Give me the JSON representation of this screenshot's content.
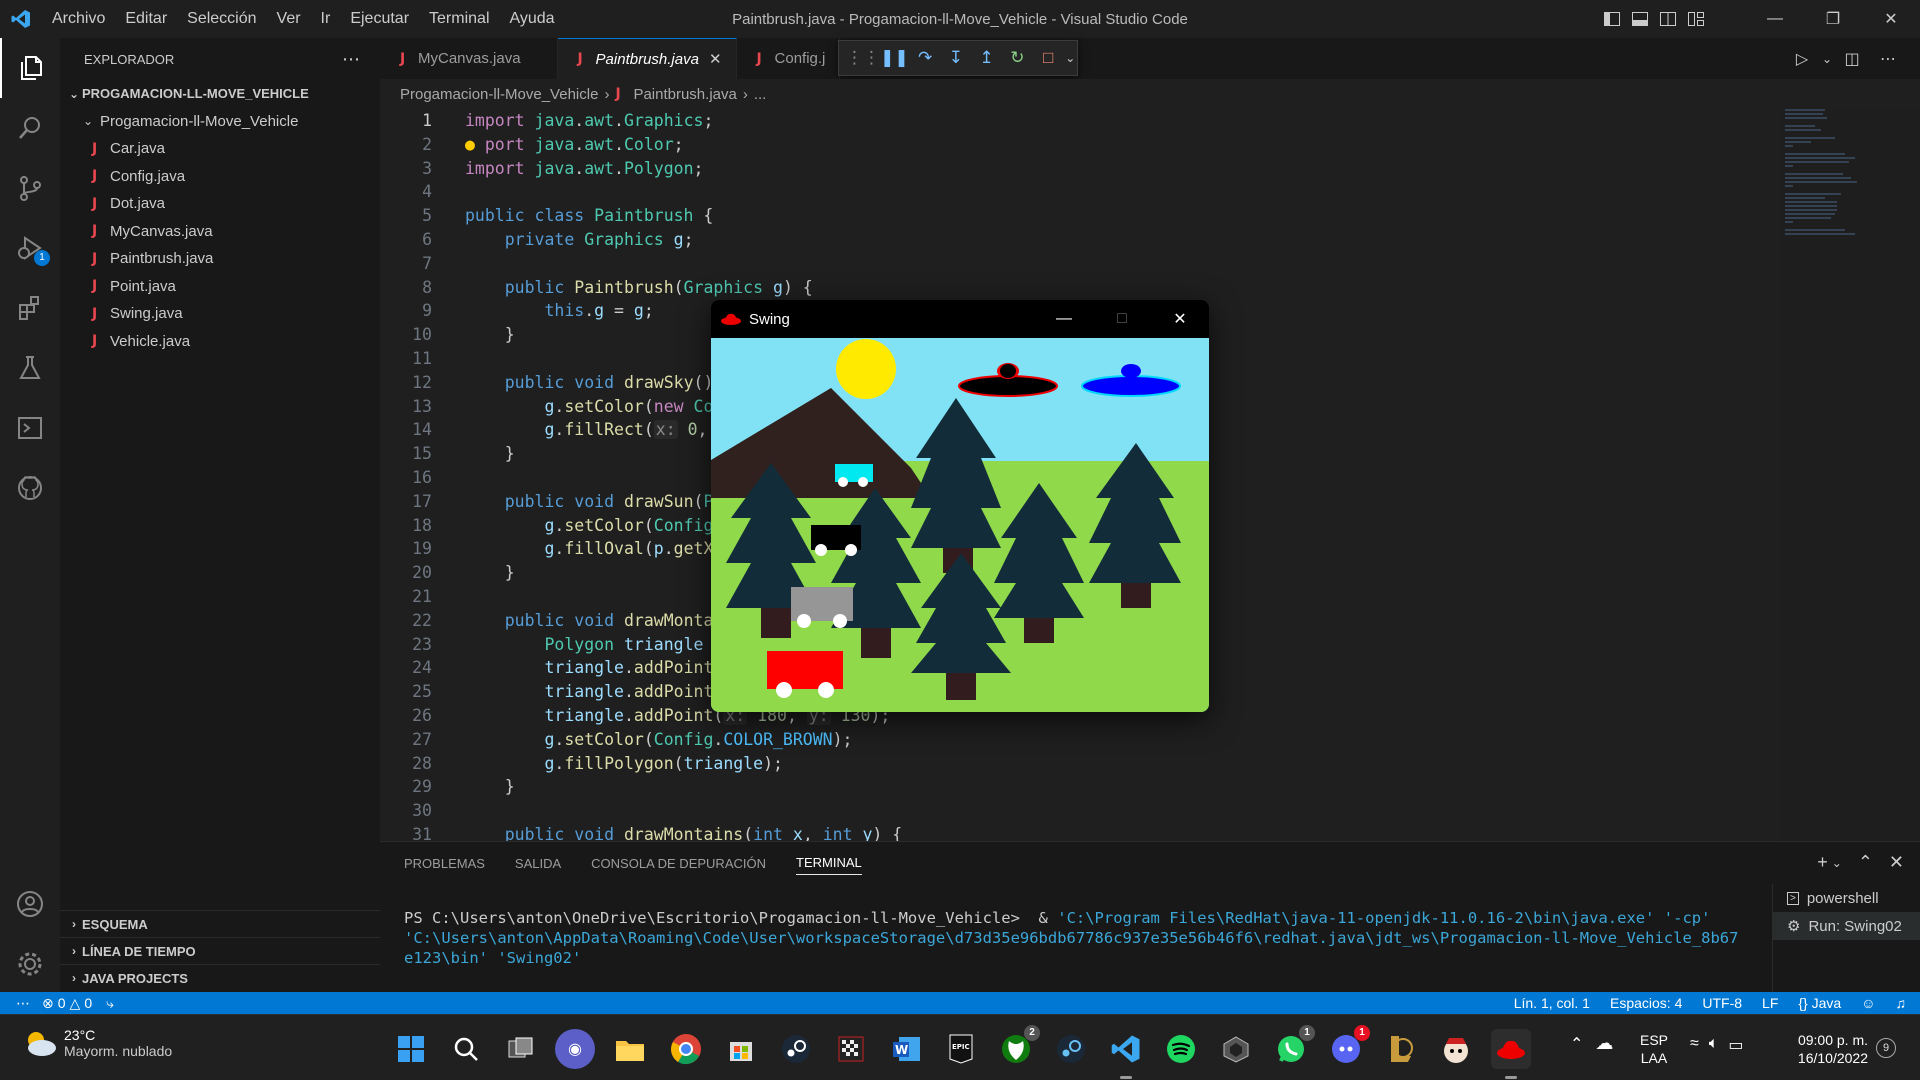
{
  "titlebar": {
    "menu": [
      "Archivo",
      "Editar",
      "Selección",
      "Ver",
      "Ir",
      "Ejecutar",
      "Terminal",
      "Ayuda"
    ],
    "window_title": "Paintbrush.java - Progamacion-ll-Move_Vehicle - Visual Studio Code"
  },
  "activity": {
    "debug_badge": "1"
  },
  "sidebar": {
    "header": "EXPLORADOR",
    "root": "PROGAMACION-LL-MOVE_VEHICLE",
    "folder": "Progamacion-ll-Move_Vehicle",
    "files": [
      "Car.java",
      "Config.java",
      "Dot.java",
      "MyCanvas.java",
      "Paintbrush.java",
      "Point.java",
      "Swing.java",
      "Vehicle.java"
    ],
    "sections": [
      "ESQUEMA",
      "LÍNEA DE TIEMPO",
      "JAVA PROJECTS"
    ]
  },
  "tabs": [
    {
      "label": "MyCanvas.java"
    },
    {
      "label": "Paintbrush.java"
    },
    {
      "label": "Config.j"
    }
  ],
  "breadcrumb": {
    "folder": "Progamacion-ll-Move_Vehicle",
    "file": "Paintbrush.java",
    "rest": "..."
  },
  "code": {
    "line_numbers": [
      "1",
      "2",
      "3",
      "4",
      "5",
      "6",
      "7",
      "8",
      "9",
      "10",
      "11",
      "12",
      "13",
      "14",
      "15",
      "16",
      "17",
      "18",
      "19",
      "20",
      "21",
      "22",
      "23",
      "24",
      "25",
      "26",
      "27",
      "28",
      "29",
      "30",
      "31"
    ]
  },
  "panel": {
    "tabs": [
      "PROBLEMAS",
      "SALIDA",
      "CONSOLA DE DEPURACIÓN",
      "TERMINAL"
    ],
    "prompt": "PS C:\\Users\\anton\\OneDrive\\Escritorio\\Progamacion-ll-Move_Vehicle>  & ",
    "cmd1": "'C:\\Program Files\\RedHat\\java-11-openjdk-11.0.16-2\\bin\\java.exe'",
    "cmd2": " '-cp' ",
    "cmd3": "'C:\\Users\\anton\\AppData\\Roaming\\Code\\User\\workspaceStorage\\d73d35e96bdb67786c937e35e56b46f6\\redhat.java\\jdt_ws\\Progamacion-ll-Move_Vehicle_8b67e123\\bin' 'Swing02'",
    "terminals": [
      "powershell",
      "Run: Swing02"
    ]
  },
  "statusbar": {
    "errors": "0",
    "warnings": "0",
    "position": "Lín. 1, col. 1",
    "spaces": "Espacios: 4",
    "encoding": "UTF-8",
    "eol": "LF",
    "language": "{} Java"
  },
  "swing": {
    "title": "Swing"
  },
  "taskbar": {
    "weather_temp": "23°C",
    "weather_desc": "Mayorm. nublado",
    "lang1": "ESP",
    "lang2": "LAA",
    "time": "09:00 p. m.",
    "date": "16/10/2022",
    "notif": "9"
  },
  "colors": {
    "accent": "#0078d4",
    "java": "#e8474f"
  }
}
